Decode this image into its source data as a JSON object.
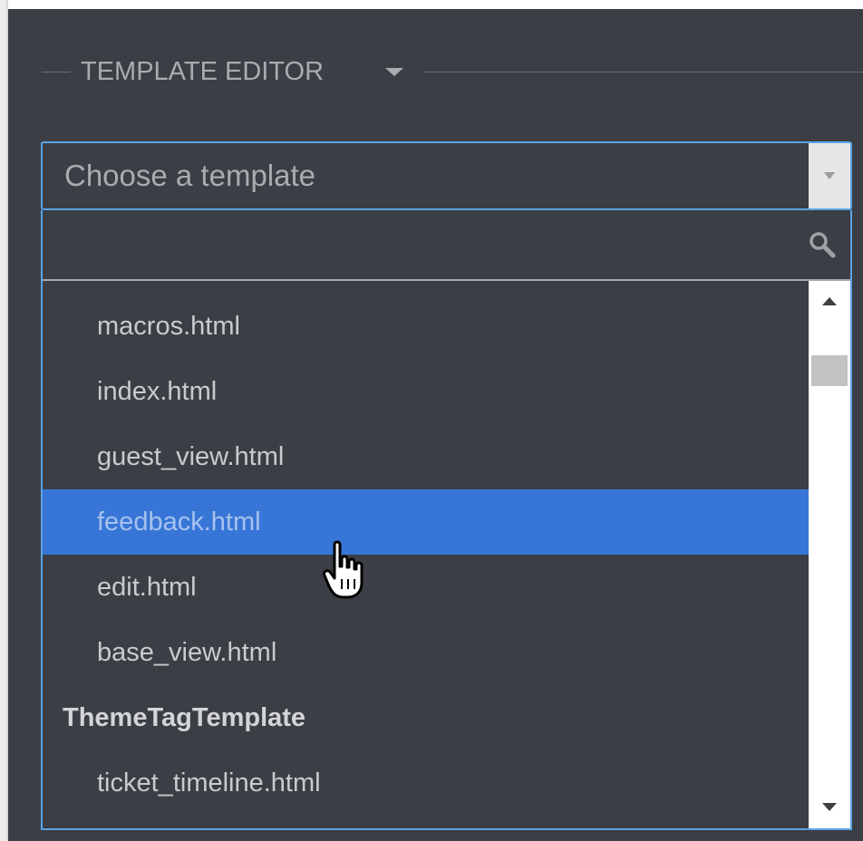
{
  "section": {
    "title": "TEMPLATE EDITOR",
    "caret_icon": "caret-down-icon"
  },
  "select": {
    "placeholder": "Choose a template",
    "arrow_icon": "chevron-down-icon"
  },
  "dropdown": {
    "search_value": "",
    "search_icon": "search-icon",
    "options": [
      {
        "label": "macros.html",
        "type": "option"
      },
      {
        "label": "index.html",
        "type": "option"
      },
      {
        "label": "guest_view.html",
        "type": "option"
      },
      {
        "label": "feedback.html",
        "type": "option",
        "highlighted": true
      },
      {
        "label": "edit.html",
        "type": "option"
      },
      {
        "label": "base_view.html",
        "type": "option"
      },
      {
        "label": "ThemeTagTemplate",
        "type": "group"
      },
      {
        "label": "ticket_timeline.html",
        "type": "option"
      }
    ]
  },
  "colors": {
    "background": "#3b3e44",
    "focus_border": "#5aa3e6",
    "highlight": "#3776d6"
  },
  "cursor_icon": "hand-pointer-icon"
}
